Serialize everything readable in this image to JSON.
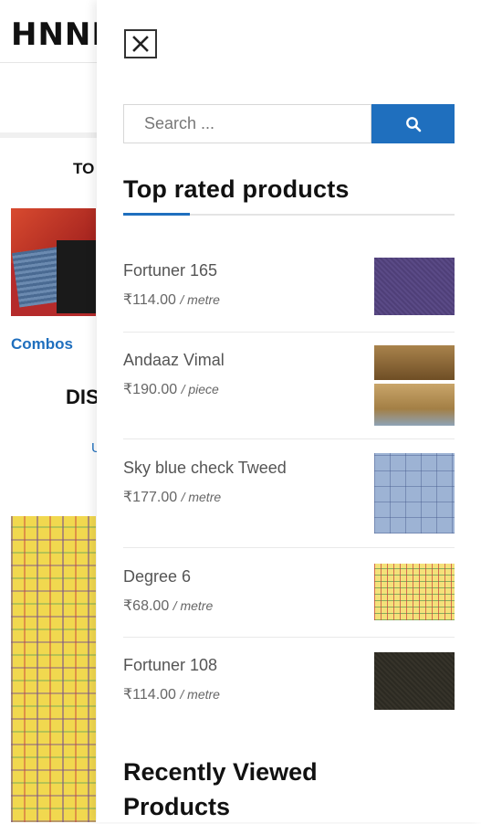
{
  "background_page": {
    "logo_text": "HNNI",
    "top_text": "TO",
    "combos_label": "Combos",
    "dis_text": "DIS",
    "u_text": "U"
  },
  "drawer": {
    "search": {
      "placeholder": "Search ...",
      "value": ""
    },
    "top_rated": {
      "title": "Top rated products",
      "products": [
        {
          "name": "Fortuner 165",
          "price": "₹114.00",
          "unit": "/ metre",
          "swatch": "purple-fabric"
        },
        {
          "name": "Andaaz Vimal",
          "price": "₹190.00",
          "unit": "/ piece",
          "swatch": "gift-box-pack"
        },
        {
          "name": "Sky blue check Tweed",
          "price": "₹177.00",
          "unit": "/ metre",
          "swatch": "blue-check-fabric"
        },
        {
          "name": "Degree 6",
          "price": "₹68.00",
          "unit": "/ metre",
          "swatch": "yellow-check-fabric"
        },
        {
          "name": "Fortuner 108",
          "price": "₹114.00",
          "unit": "/ metre",
          "swatch": "dark-olive-fabric"
        }
      ]
    },
    "recently_viewed": {
      "title": "Recently Viewed Products"
    }
  },
  "colors": {
    "accent": "#1f6fbe",
    "text": "#111111",
    "muted": "#555555"
  }
}
